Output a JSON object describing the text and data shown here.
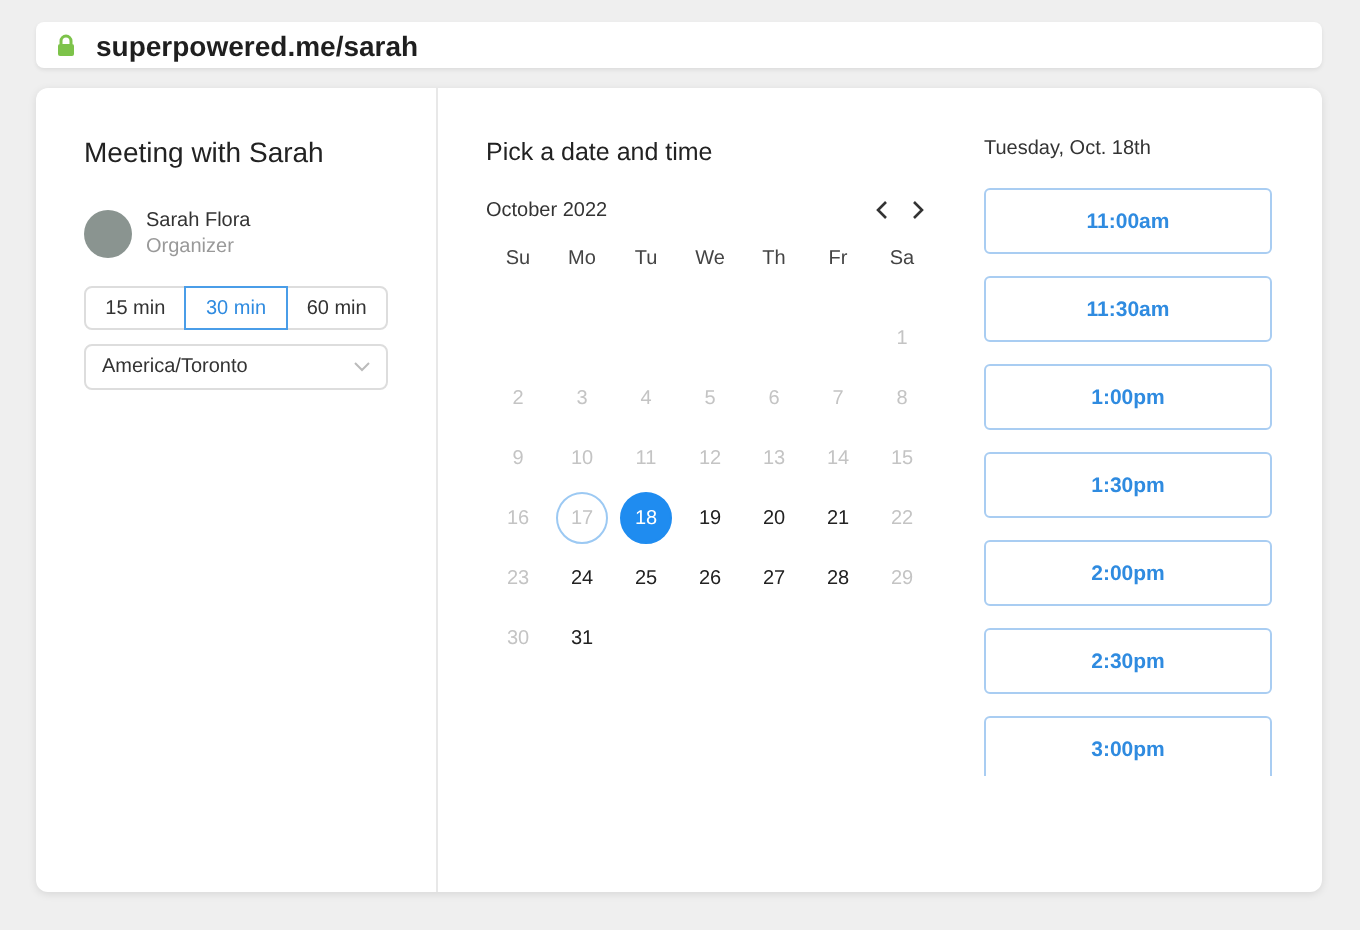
{
  "address_bar": {
    "url": "superpowered.me/sarah"
  },
  "meeting": {
    "title": "Meeting with Sarah",
    "organizer": {
      "name": "Sarah Flora",
      "role": "Organizer"
    },
    "durations": [
      {
        "label": "15 min",
        "selected": false
      },
      {
        "label": "30 min",
        "selected": true
      },
      {
        "label": "60 min",
        "selected": false
      }
    ],
    "timezone": "America/Toronto"
  },
  "calendar": {
    "heading": "Pick a date and time",
    "month": "October 2022",
    "weekdays": [
      "Su",
      "Mo",
      "Tu",
      "We",
      "Th",
      "Fr",
      "Sa"
    ],
    "days": [
      {
        "kind": "blank"
      },
      {
        "kind": "blank"
      },
      {
        "kind": "blank"
      },
      {
        "kind": "blank"
      },
      {
        "kind": "blank"
      },
      {
        "kind": "blank"
      },
      {
        "kind": "day",
        "day": "1",
        "available": false,
        "selected": false,
        "today": false
      },
      {
        "kind": "day",
        "day": "2",
        "available": false,
        "selected": false,
        "today": false
      },
      {
        "kind": "day",
        "day": "3",
        "available": false,
        "selected": false,
        "today": false
      },
      {
        "kind": "day",
        "day": "4",
        "available": false,
        "selected": false,
        "today": false
      },
      {
        "kind": "day",
        "day": "5",
        "available": false,
        "selected": false,
        "today": false
      },
      {
        "kind": "day",
        "day": "6",
        "available": false,
        "selected": false,
        "today": false
      },
      {
        "kind": "day",
        "day": "7",
        "available": false,
        "selected": false,
        "today": false
      },
      {
        "kind": "day",
        "day": "8",
        "available": false,
        "selected": false,
        "today": false
      },
      {
        "kind": "day",
        "day": "9",
        "available": false,
        "selected": false,
        "today": false
      },
      {
        "kind": "day",
        "day": "10",
        "available": false,
        "selected": false,
        "today": false
      },
      {
        "kind": "day",
        "day": "11",
        "available": false,
        "selected": false,
        "today": false
      },
      {
        "kind": "day",
        "day": "12",
        "available": false,
        "selected": false,
        "today": false
      },
      {
        "kind": "day",
        "day": "13",
        "available": false,
        "selected": false,
        "today": false
      },
      {
        "kind": "day",
        "day": "14",
        "available": false,
        "selected": false,
        "today": false
      },
      {
        "kind": "day",
        "day": "15",
        "available": false,
        "selected": false,
        "today": false
      },
      {
        "kind": "day",
        "day": "16",
        "available": false,
        "selected": false,
        "today": false
      },
      {
        "kind": "day",
        "day": "17",
        "available": false,
        "selected": false,
        "today": true
      },
      {
        "kind": "day",
        "day": "18",
        "available": true,
        "selected": true,
        "today": false
      },
      {
        "kind": "day",
        "day": "19",
        "available": true,
        "selected": false,
        "today": false
      },
      {
        "kind": "day",
        "day": "20",
        "available": true,
        "selected": false,
        "today": false
      },
      {
        "kind": "day",
        "day": "21",
        "available": true,
        "selected": false,
        "today": false
      },
      {
        "kind": "day",
        "day": "22",
        "available": false,
        "selected": false,
        "today": false
      },
      {
        "kind": "day",
        "day": "23",
        "available": false,
        "selected": false,
        "today": false
      },
      {
        "kind": "day",
        "day": "24",
        "available": true,
        "selected": false,
        "today": false
      },
      {
        "kind": "day",
        "day": "25",
        "available": true,
        "selected": false,
        "today": false
      },
      {
        "kind": "day",
        "day": "26",
        "available": true,
        "selected": false,
        "today": false
      },
      {
        "kind": "day",
        "day": "27",
        "available": true,
        "selected": false,
        "today": false
      },
      {
        "kind": "day",
        "day": "28",
        "available": true,
        "selected": false,
        "today": false
      },
      {
        "kind": "day",
        "day": "29",
        "available": false,
        "selected": false,
        "today": false
      },
      {
        "kind": "day",
        "day": "30",
        "available": false,
        "selected": false,
        "today": false
      },
      {
        "kind": "day",
        "day": "31",
        "available": true,
        "selected": false,
        "today": false
      }
    ]
  },
  "times": {
    "date": "Tuesday, Oct. 18th",
    "slots": [
      "11:00am",
      "11:30am",
      "1:00pm",
      "1:30pm",
      "2:00pm",
      "2:30pm",
      "3:00pm"
    ]
  }
}
